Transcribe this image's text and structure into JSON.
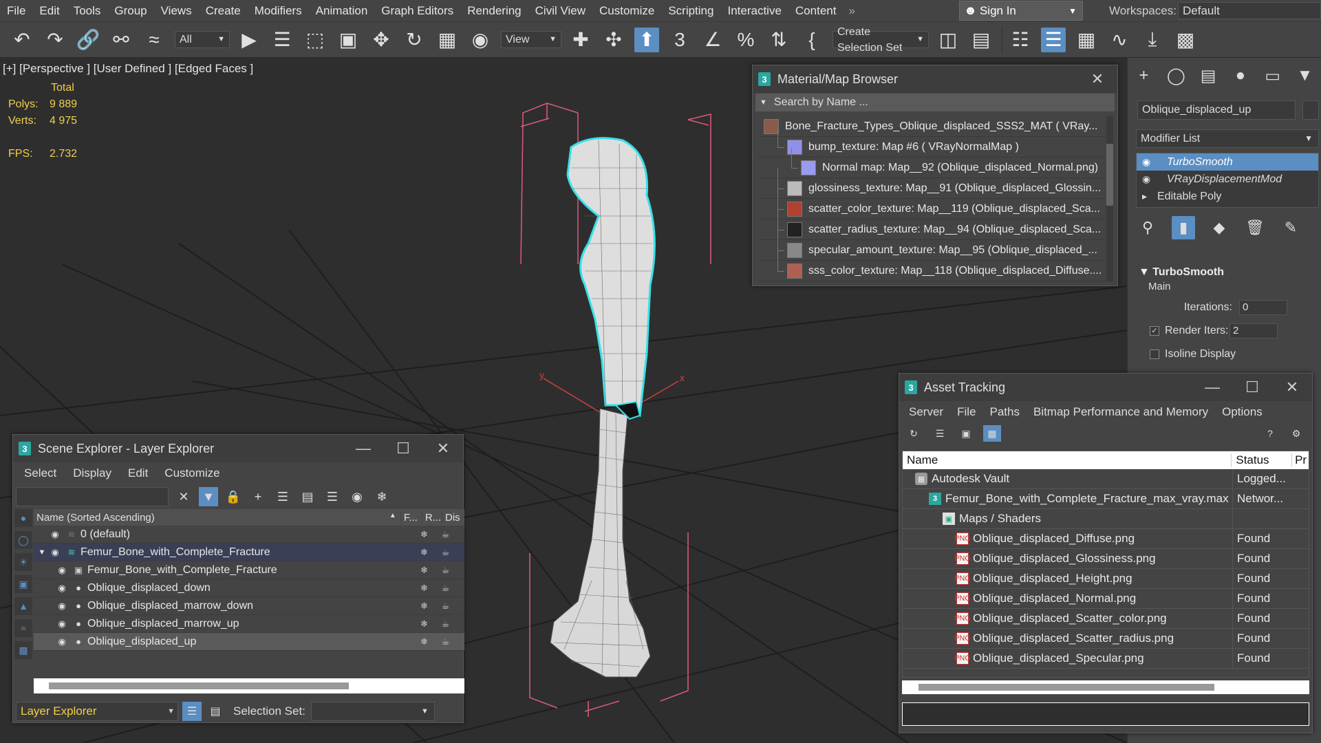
{
  "menubar": {
    "items": [
      "File",
      "Edit",
      "Tools",
      "Group",
      "Views",
      "Create",
      "Modifiers",
      "Animation",
      "Graph Editors",
      "Rendering",
      "Civil View",
      "Customize",
      "Scripting",
      "Interactive",
      "Content"
    ],
    "more": "»",
    "signin": "Sign In",
    "workspaces_label": "Workspaces:",
    "workspace_value": "Default"
  },
  "toolbar": {
    "selection_filter": "All",
    "ref_coord": "View",
    "selection_set": "Create Selection Set",
    "icons": {
      "undo": "undo-icon",
      "redo": "redo-icon"
    }
  },
  "viewport": {
    "label": "[+] [Perspective ] [User Defined ] [Edged Faces ]",
    "stats": {
      "total_label": "Total",
      "polys_label": "Polys:",
      "polys_value": "9 889",
      "verts_label": "Verts:",
      "verts_value": "4 975",
      "fps_label": "FPS:",
      "fps_value": "2.732"
    },
    "axis_x": "x",
    "axis_y": "y"
  },
  "material_browser": {
    "title": "Material/Map Browser",
    "search_placeholder": "Search by Name ...",
    "rows": [
      {
        "text": "Bone_Fracture_Types_Oblique_displaced_SSS2_MAT    ( VRay...",
        "indent": 0,
        "color": "#8a5a4a"
      },
      {
        "text": "bump_texture: Map #6  ( VRayNormalMap )",
        "indent": 1,
        "color": "#9090e8"
      },
      {
        "text": "Normal map: Map__92 (Oblique_displaced_Normal.png)",
        "indent": 2,
        "color": "#9a9af0"
      },
      {
        "text": "glossiness_texture:  Map__91  (Oblique_displaced_Glossin...",
        "indent": 1,
        "color": "#bbbbbb"
      },
      {
        "text": "scatter_color_texture:  Map__119  (Oblique_displaced_Sca...",
        "indent": 1,
        "color": "#b04030"
      },
      {
        "text": "scatter_radius_texture:  Map__94  (Oblique_displaced_Sca...",
        "indent": 1,
        "color": "#222222"
      },
      {
        "text": "specular_amount_texture:  Map__95  (Oblique_displaced_...",
        "indent": 1,
        "color": "#888888"
      },
      {
        "text": "sss_color_texture:  Map__118  (Oblique_displaced_Diffuse....",
        "indent": 1,
        "color": "#b06050"
      }
    ]
  },
  "command_panel": {
    "object_name": "Oblique_displaced_up",
    "modifier_list": "Modifier List",
    "stack": [
      {
        "label": "TurboSmooth",
        "state": "selected"
      },
      {
        "label": "VRayDisplacementMod",
        "state": "italic"
      },
      {
        "label": "Editable Poly",
        "state": "base"
      }
    ],
    "rollout_title": "TurboSmooth",
    "main_label": "Main",
    "iterations_label": "Iterations:",
    "iterations_value": "0",
    "render_iters_label": "Render Iters:",
    "render_iters_value": "2",
    "isoline_label": "Isoline Display"
  },
  "asset_tracking": {
    "title": "Asset Tracking",
    "menu": [
      "Server",
      "File",
      "Paths",
      "Bitmap Performance and Memory",
      "Options"
    ],
    "columns": [
      "Name",
      "Status",
      "Pr"
    ],
    "rows": [
      {
        "name": "Autodesk Vault",
        "status": "Logged...",
        "indent": 0,
        "icon": "vault"
      },
      {
        "name": "Femur_Bone_with_Complete_Fracture_max_vray.max",
        "status": "Networ...",
        "indent": 1,
        "icon": "max"
      },
      {
        "name": "Maps / Shaders",
        "status": "",
        "indent": 2,
        "icon": "folder"
      },
      {
        "name": "Oblique_displaced_Diffuse.png",
        "status": "Found",
        "indent": 3,
        "icon": "png"
      },
      {
        "name": "Oblique_displaced_Glossiness.png",
        "status": "Found",
        "indent": 3,
        "icon": "png"
      },
      {
        "name": "Oblique_displaced_Height.png",
        "status": "Found",
        "indent": 3,
        "icon": "png"
      },
      {
        "name": "Oblique_displaced_Normal.png",
        "status": "Found",
        "indent": 3,
        "icon": "png"
      },
      {
        "name": "Oblique_displaced_Scatter_color.png",
        "status": "Found",
        "indent": 3,
        "icon": "png"
      },
      {
        "name": "Oblique_displaced_Scatter_radius.png",
        "status": "Found",
        "indent": 3,
        "icon": "png"
      },
      {
        "name": "Oblique_displaced_Specular.png",
        "status": "Found",
        "indent": 3,
        "icon": "png"
      }
    ]
  },
  "scene_explorer": {
    "title": "Scene Explorer - Layer Explorer",
    "menu": [
      "Select",
      "Display",
      "Edit",
      "Customize"
    ],
    "columns": {
      "name": "Name (Sorted Ascending)",
      "f": "F...",
      "r": "R...",
      "d": "Dis"
    },
    "rows": [
      {
        "name": "0 (default)",
        "indent": 0,
        "type": "layer-default",
        "state": ""
      },
      {
        "name": "Femur_Bone_with_Complete_Fracture",
        "indent": 0,
        "type": "layer",
        "state": "hl"
      },
      {
        "name": "Femur_Bone_with_Complete_Fracture",
        "indent": 1,
        "type": "group",
        "state": ""
      },
      {
        "name": "Oblique_displaced_down",
        "indent": 1,
        "type": "object",
        "state": ""
      },
      {
        "name": "Oblique_displaced_marrow_down",
        "indent": 1,
        "type": "object",
        "state": ""
      },
      {
        "name": "Oblique_displaced_marrow_up",
        "indent": 1,
        "type": "object",
        "state": ""
      },
      {
        "name": "Oblique_displaced_up",
        "indent": 1,
        "type": "object",
        "state": "sel"
      }
    ],
    "mode": "Layer Explorer",
    "selection_set_label": "Selection Set:"
  }
}
